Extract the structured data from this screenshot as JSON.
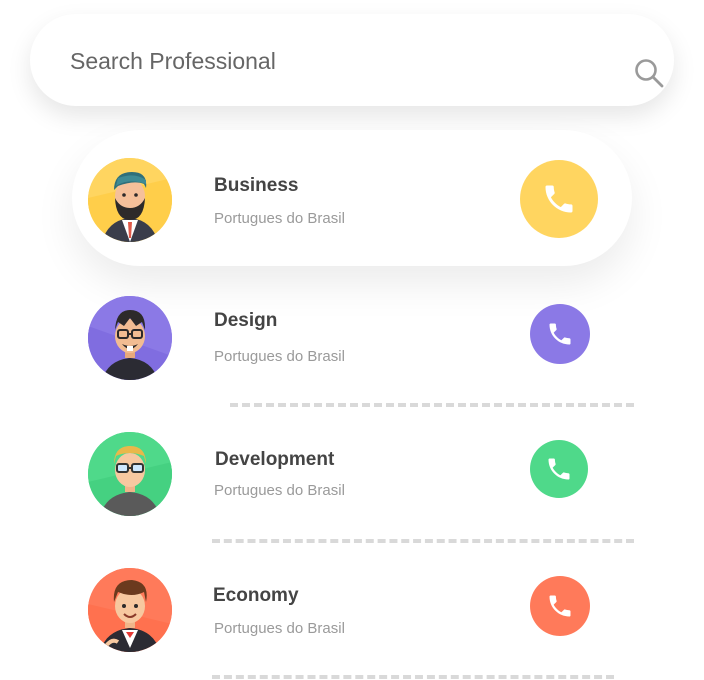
{
  "search": {
    "placeholder": "Search Professional"
  },
  "professionals": [
    {
      "title": "Business",
      "subtitle": "Portugues do Brasil",
      "color": "#ffd560",
      "avatar_icon": "bearded-man-avatar",
      "call_icon": "phone-icon"
    },
    {
      "title": "Design",
      "subtitle": "Portugues do Brasil",
      "color": "#8b79e6",
      "avatar_icon": "glasses-man-avatar",
      "call_icon": "phone-icon"
    },
    {
      "title": "Development",
      "subtitle": "Portugues do Brasil",
      "color": "#4fd98a",
      "avatar_icon": "blonde-glasses-avatar",
      "call_icon": "phone-icon"
    },
    {
      "title": "Economy",
      "subtitle": "Portugues do Brasil",
      "color": "#ff7a5a",
      "avatar_icon": "suit-man-avatar",
      "call_icon": "phone-icon"
    }
  ]
}
